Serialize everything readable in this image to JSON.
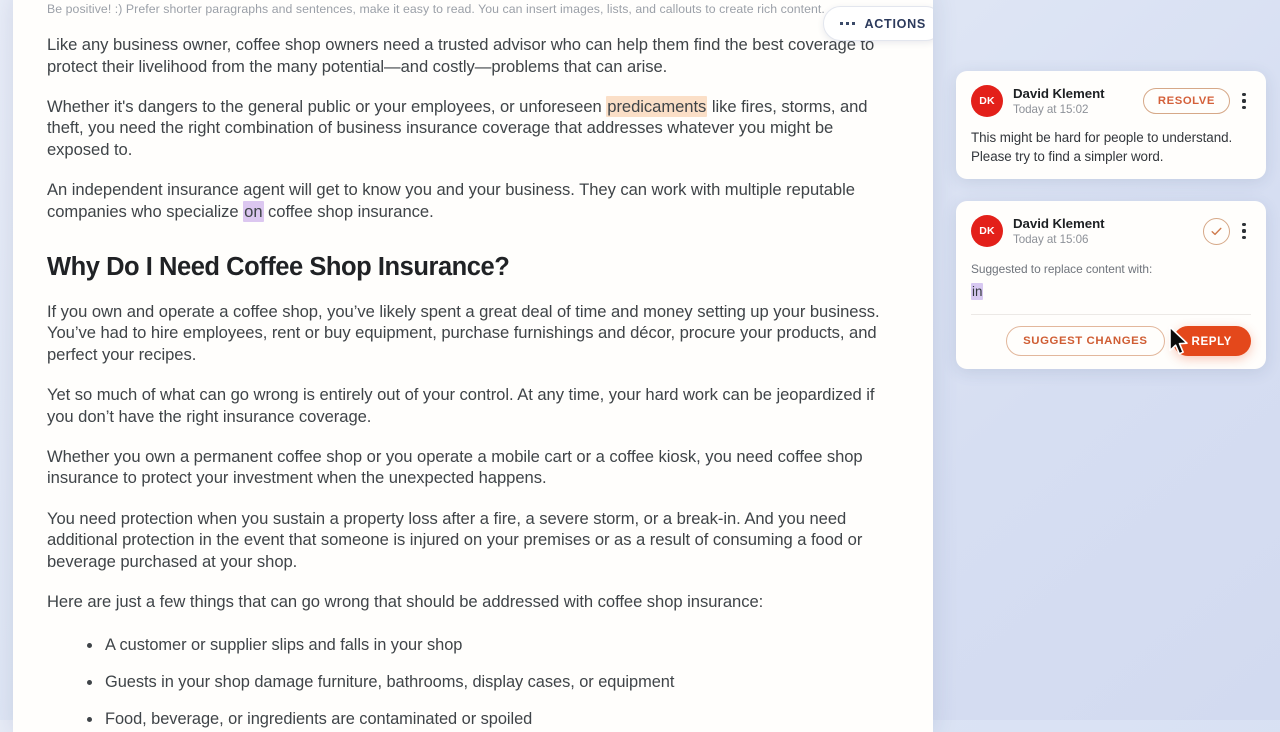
{
  "theme": {
    "background_start": "#e9edf8",
    "background_end": "#d2daf0",
    "document_bg": "#fffefc",
    "accent_orange": "#e4481b",
    "accent_orange_text": "#cf5c32",
    "avatar_red": "#e3201a",
    "actions_navy": "#2c3a5c",
    "highlight_orange": "#fbdfc7",
    "highlight_purple": "#dcc7f0"
  },
  "editor": {
    "tip": "Be positive! :) Prefer shorter paragraphs and sentences, make it easy to read. You can insert images, lists, and callouts to create rich content.",
    "actions_button": {
      "label": "ACTIONS",
      "icon": "three-dots-icon"
    },
    "paragraphs": {
      "p1_a": "Like any business owner, coffee shop owners need a trusted advisor who can help them find the best coverage to protect their livelihood from the many potential—and costly—problems that can arise.",
      "p2_a": "Whether it's dangers to the general public or your employees, or unforeseen ",
      "p2_highlight": "predicaments",
      "p2_b": " like fires, storms, and theft, you need the right combination of business insurance coverage that addresses whatever you might be exposed to.",
      "p3_a": "An independent insurance agent will get to know you and your business. They can work with multiple reputable companies who specialize ",
      "p3_highlight": "on",
      "p3_b": " coffee shop insurance.",
      "heading": "Why Do I Need Coffee Shop Insurance?",
      "p4": "If you own and operate a coffee shop, you’ve likely spent a great deal of time and money setting up your business. You’ve had to hire employees, rent or buy equipment, purchase furnishings and décor, procure your products, and perfect your recipes.",
      "p5": "Yet so much of what can go wrong is entirely out of your control. At any time, your hard work can be jeopardized if you don’t have the right insurance coverage.",
      "p6": "Whether you own a permanent coffee shop or you operate a mobile cart or a coffee kiosk, you need coffee shop insurance to protect your investment when the unexpected happens.",
      "p7": "You need protection when you sustain a property loss after a fire, a severe storm, or a break-in. And you need additional protection in the event that someone is injured on your premises or as a result of consuming a food or beverage purchased at your shop.",
      "p8": "Here are just a few things that can go wrong that should be addressed with coffee shop insurance:"
    },
    "bullets": [
      "A customer or supplier slips and falls in your shop",
      "Guests in your shop damage furniture, bathrooms, display cases, or equipment",
      "Food, beverage, or ingredients are contaminated or spoiled"
    ]
  },
  "comments": [
    {
      "avatar_initials": "DK",
      "author": "David Klement",
      "timestamp": "Today at 15:02",
      "resolve_label": "RESOLVE",
      "body": "This might be hard for people to understand. Please try to find a simpler word.",
      "menu_icon": "kebab-menu-icon"
    },
    {
      "avatar_initials": "DK",
      "author": "David Klement",
      "timestamp": "Today at 15:06",
      "resolve_icon": "check-circle-icon",
      "suggestion_label": "Suggested to replace content with:",
      "suggestion_value": "in",
      "suggest_changes_label": "SUGGEST CHANGES",
      "reply_label": "REPLY",
      "menu_icon": "kebab-menu-icon"
    }
  ],
  "cursor": {
    "icon": "mouse-pointer-icon"
  }
}
